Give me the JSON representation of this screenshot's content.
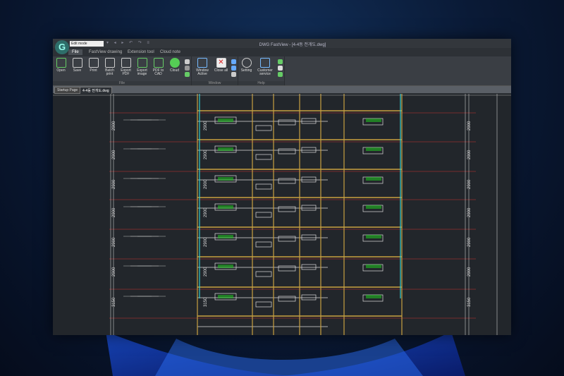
{
  "window": {
    "title": "DWG FastView - [4-4동 전개도.dwg]",
    "mode": "Edit mode"
  },
  "menu_tabs": [
    "File",
    "FastView drawing",
    "Extension tool",
    "Cloud note"
  ],
  "ribbon": {
    "file_group": {
      "label": "File",
      "buttons": [
        "Open",
        "Save",
        "Print",
        "Batch print",
        "Export PDF",
        "Export image",
        "PDF to CAD",
        "Cloud"
      ]
    },
    "window_group": {
      "label": "Window",
      "buttons": [
        "Window Active",
        "Close all"
      ]
    },
    "help_group": {
      "label": "Help",
      "buttons": [
        "Setting",
        "Customer service"
      ]
    }
  },
  "doc_tabs": [
    "Startup Page",
    "4-4동 전개도.dwg"
  ],
  "drawing": {
    "dims": [
      "2900",
      "2900",
      "2900",
      "2900",
      "2900",
      "2900",
      "3150"
    ]
  }
}
